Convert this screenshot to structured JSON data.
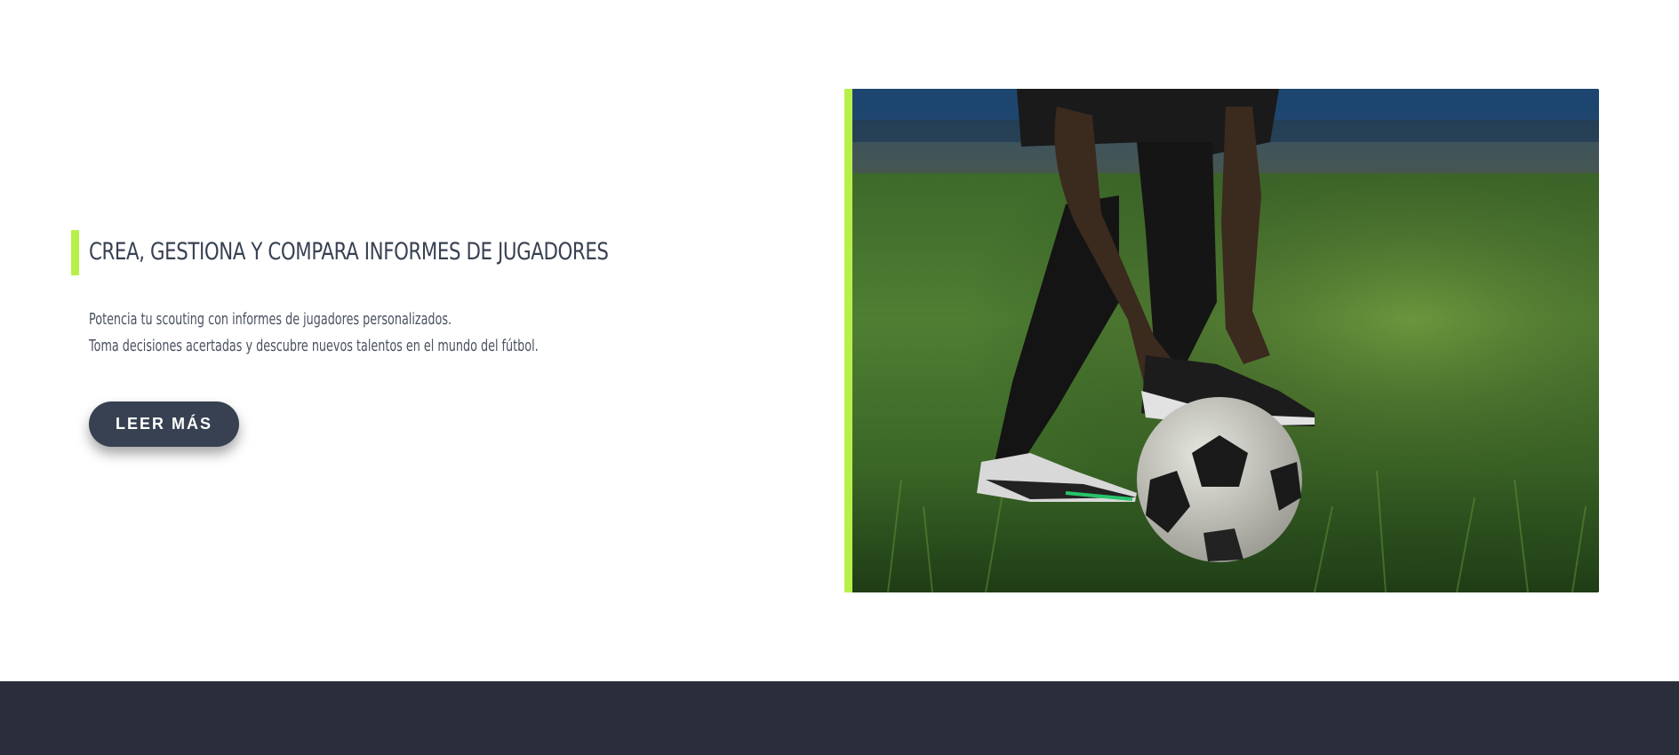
{
  "feature": {
    "heading": "CREA, GESTIONA Y COMPARA INFORMES DE JUGADORES",
    "description_lines": [
      "Potencia tu scouting con informes de jugadores personalizados.",
      "Toma decisiones acertadas y descubre nuevos talentos en el mundo del fútbol."
    ],
    "cta_label": "LEER MÁS"
  },
  "colors": {
    "accent": "#b8f04a",
    "heading": "#384152",
    "button": "#374151",
    "footer": "#2a2d3a"
  }
}
